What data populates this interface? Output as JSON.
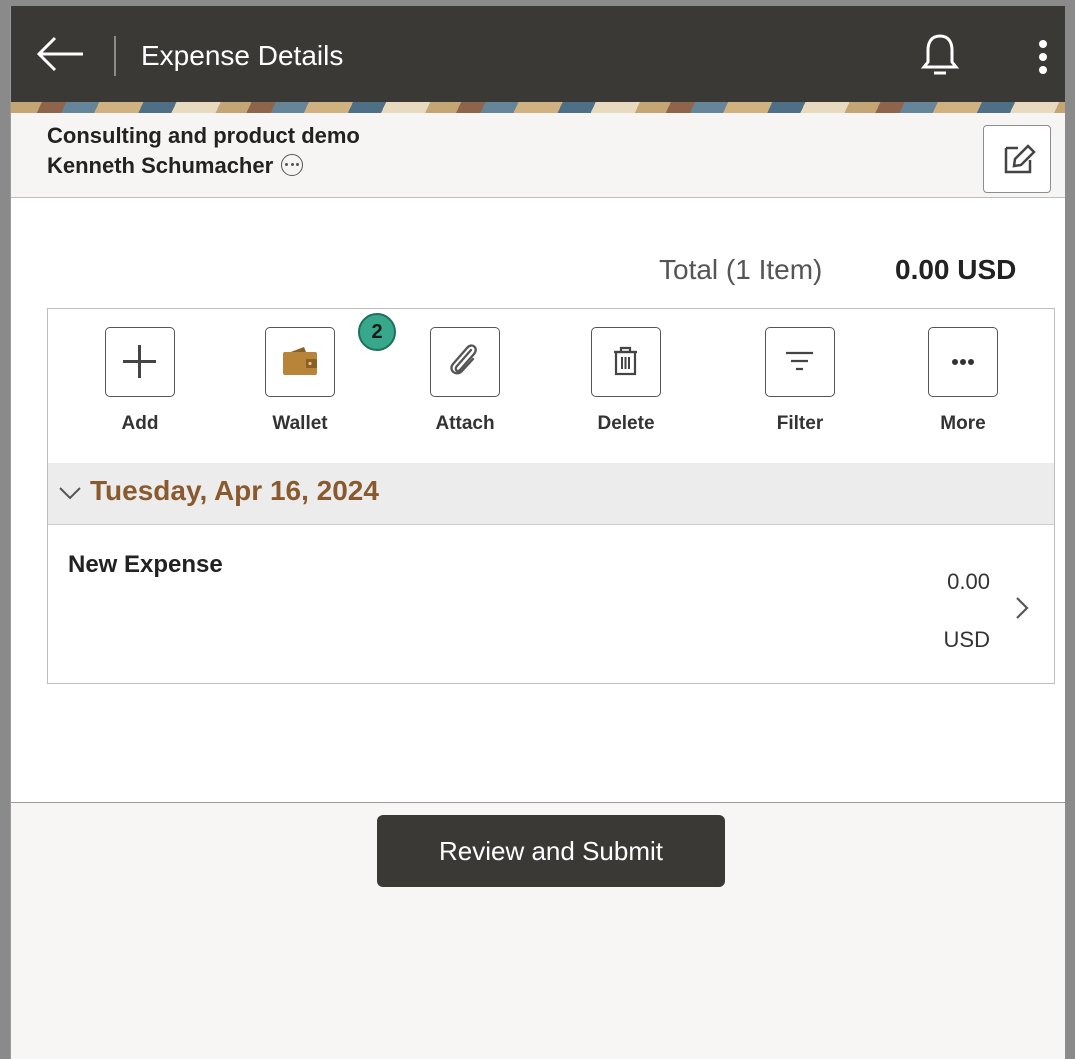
{
  "header": {
    "title": "Expense Details",
    "back_icon": "arrow-left-icon",
    "notifications_icon": "bell-icon",
    "menu_icon": "kebab-icon"
  },
  "context": {
    "report_name": "Consulting and product demo",
    "employee_name": "Kenneth Schumacher",
    "edit_icon": "edit-icon"
  },
  "summary": {
    "total_label": "Total (1 Item)",
    "total_value": "0.00 USD"
  },
  "toolbar": {
    "items": [
      {
        "label": "Add",
        "icon": "plus-icon"
      },
      {
        "label": "Wallet",
        "icon": "wallet-icon",
        "badge": "2"
      },
      {
        "label": "Attach",
        "icon": "paperclip-icon"
      },
      {
        "label": "Delete",
        "icon": "trash-icon"
      },
      {
        "label": "Filter",
        "icon": "filter-icon"
      },
      {
        "label": "More",
        "icon": "more-icon"
      }
    ]
  },
  "groups": [
    {
      "date": "Tuesday, Apr 16, 2024",
      "expenses": [
        {
          "name": "New Expense",
          "amount": "0.00",
          "currency": "USD"
        }
      ]
    }
  ],
  "footer": {
    "submit_label": "Review and Submit"
  },
  "colors": {
    "header_bg": "#3b3936",
    "date_text": "#8a5a2f",
    "badge_bg": "#38a88c",
    "wallet_icon": "#b78439"
  }
}
